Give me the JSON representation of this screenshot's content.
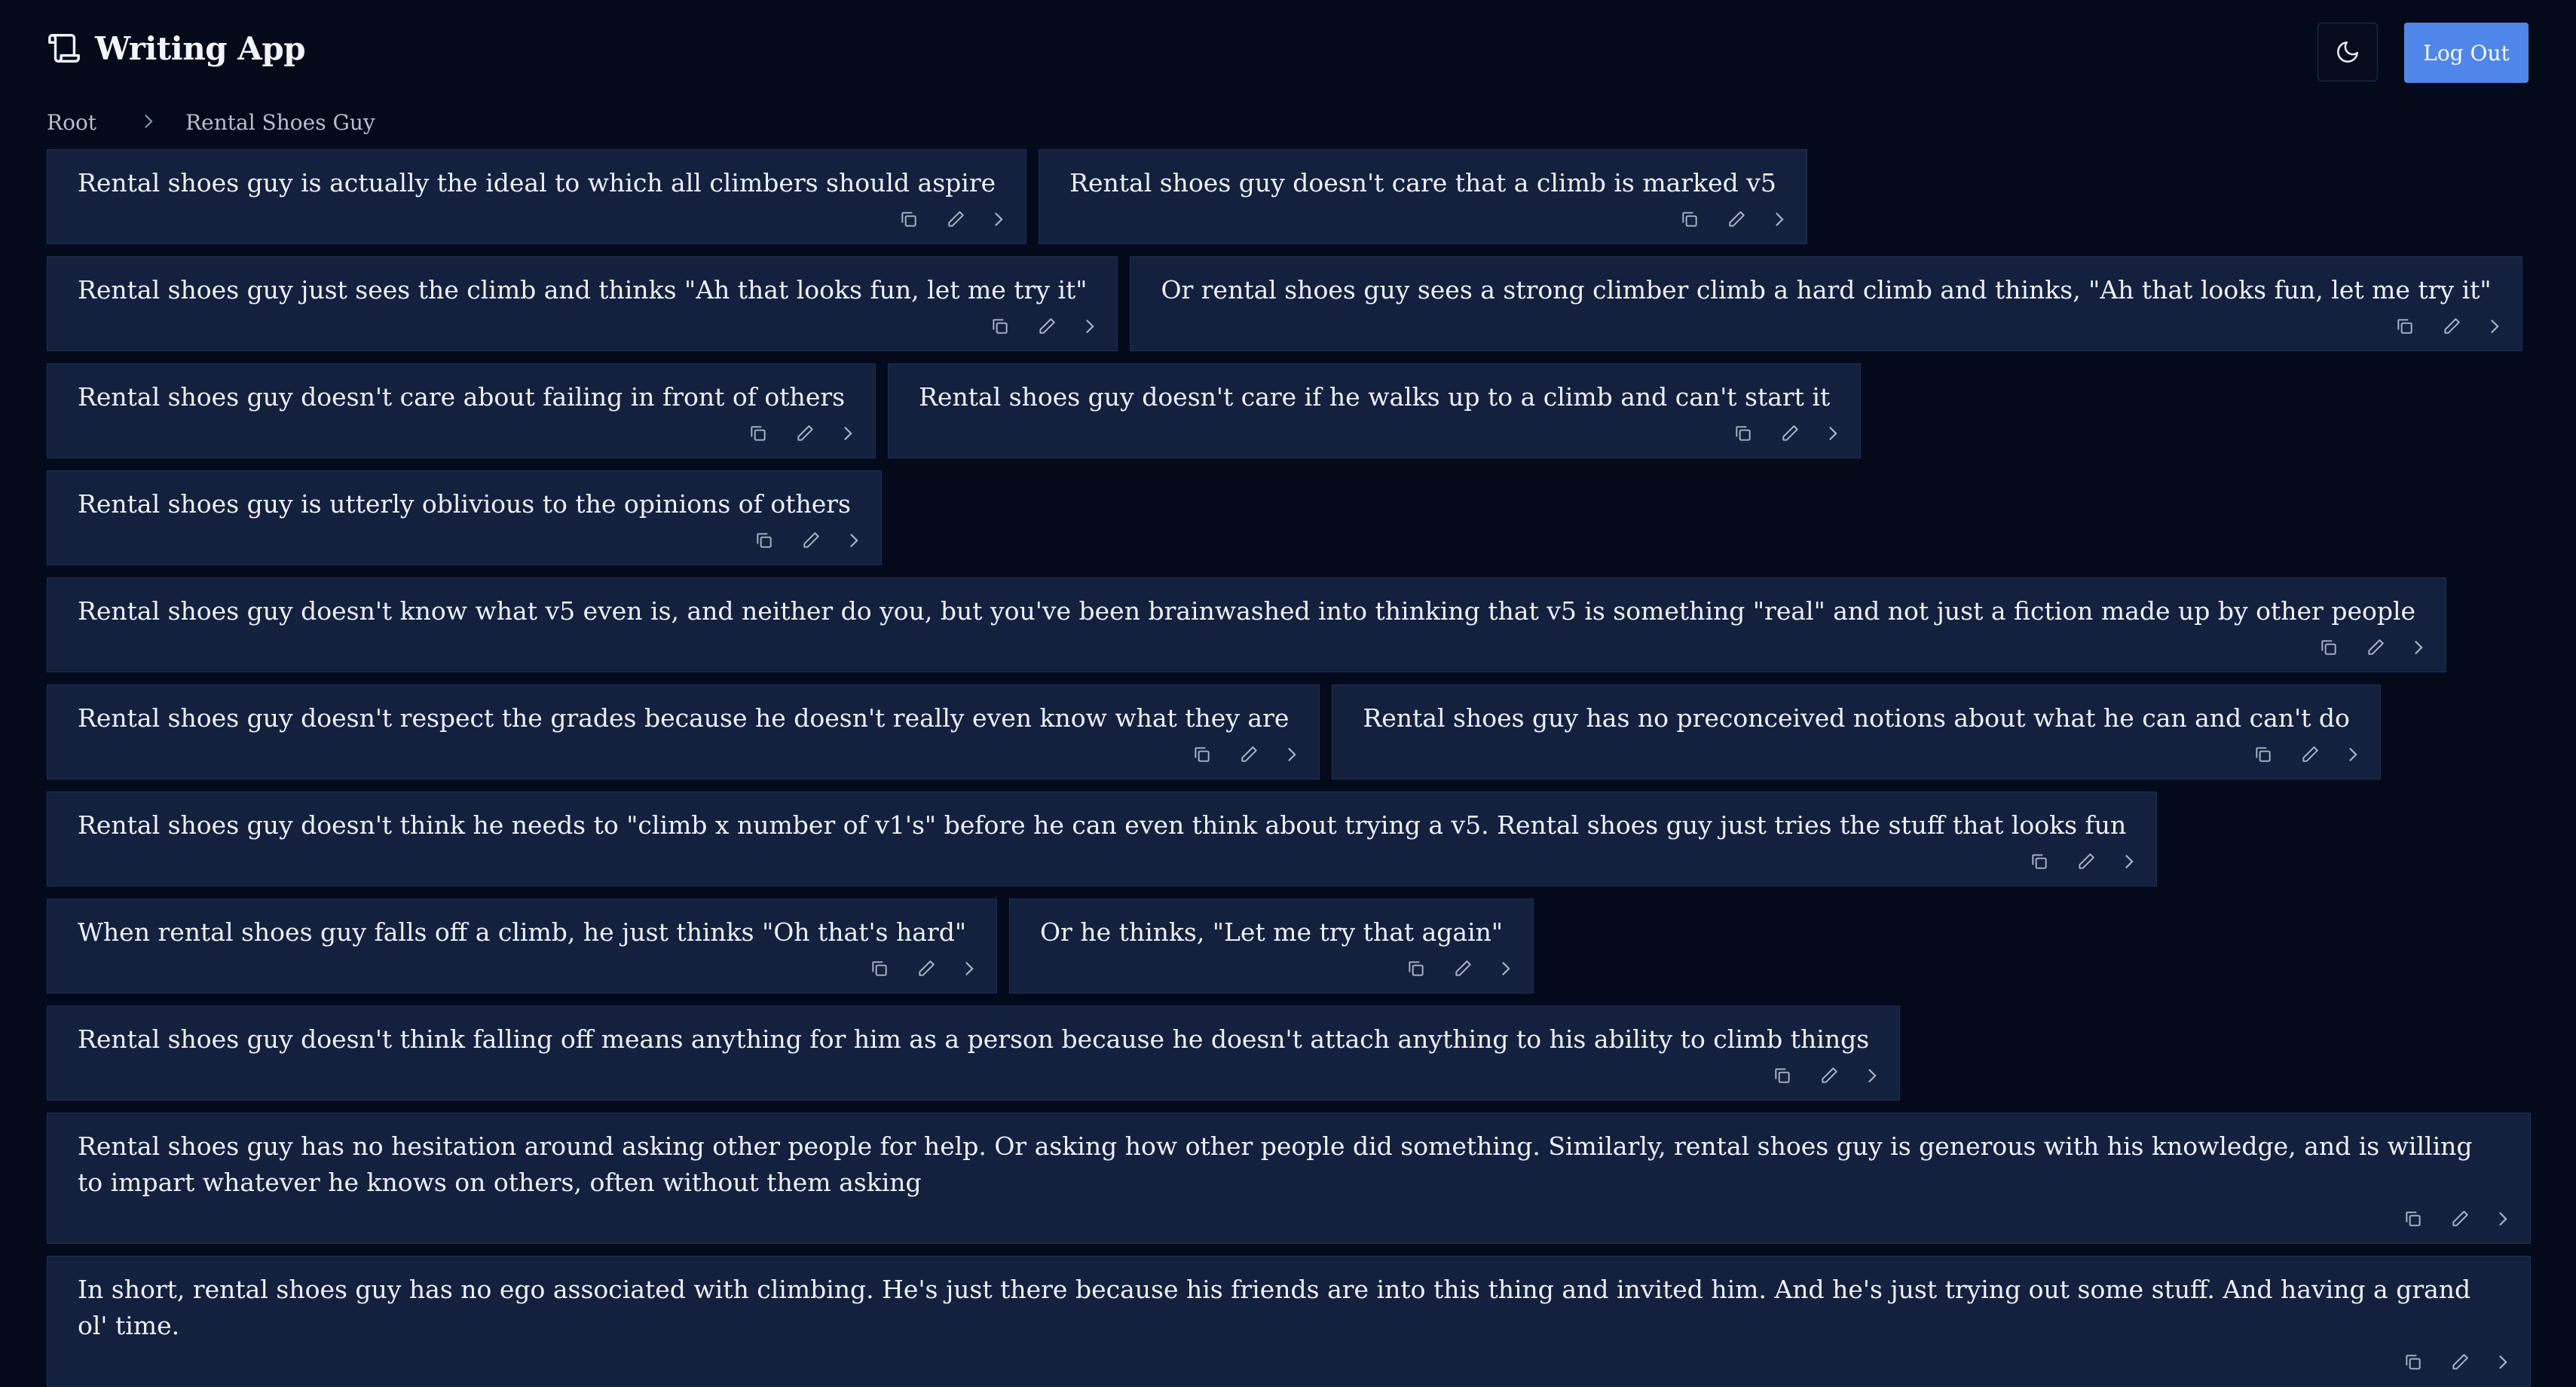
{
  "app": {
    "title": "Writing App",
    "logo_icon": "scroll-icon",
    "theme_icon": "moon-icon",
    "logout_label": "Log Out",
    "accent_color": "#4f86e8",
    "background_color": "#030a1a",
    "card_color": "#13213f"
  },
  "breadcrumb": [
    "Root",
    "Rental Shoes Guy"
  ],
  "cards": [
    "Rental shoes guy is actually the ideal to which all climbers should aspire",
    "Rental shoes guy doesn't care that a climb is marked v5",
    "Rental shoes guy just sees the climb and thinks \"Ah that looks fun, let me try it\"",
    "Or rental shoes guy sees a strong climber climb a hard climb and thinks, \"Ah that looks fun, let me try it\"",
    "Rental shoes guy doesn't care about failing in front of others",
    "Rental shoes guy doesn't care if he walks up to a climb and can't start it",
    "Rental shoes guy is utterly oblivious to the opinions of others",
    "Rental shoes guy doesn't know what v5 even is, and neither do you, but you've been brainwashed into thinking that v5 is something \"real\" and not just a fiction made up by other people",
    "Rental shoes guy doesn't respect the grades because he doesn't really even know what they are",
    "Rental shoes guy has no preconceived notions about what he can and can't do",
    "Rental shoes guy doesn't think he needs to \"climb x number of v1's\" before he can even think about trying a v5. Rental shoes guy just tries the stuff that looks fun",
    "When rental shoes guy falls off a climb, he just thinks \"Oh that's hard\"",
    "Or he thinks, \"Let me try that again\"",
    "Rental shoes guy doesn't think falling off means anything for him as a person because he doesn't attach anything to his ability to climb things",
    "Rental shoes guy has no hesitation around asking other people for help. Or asking how other people did something. Similarly, rental shoes guy is generous with his knowledge, and is willing to impart whatever he knows on others, often without them asking",
    "In short, rental shoes guy has no ego associated with climbing. He's just there because his friends are into this thing and invited him. And he's just trying out some stuff. And having a grand ol' time."
  ],
  "card_action_icons": [
    "copy-icon",
    "edit-icon",
    "chevron-right-icon"
  ]
}
